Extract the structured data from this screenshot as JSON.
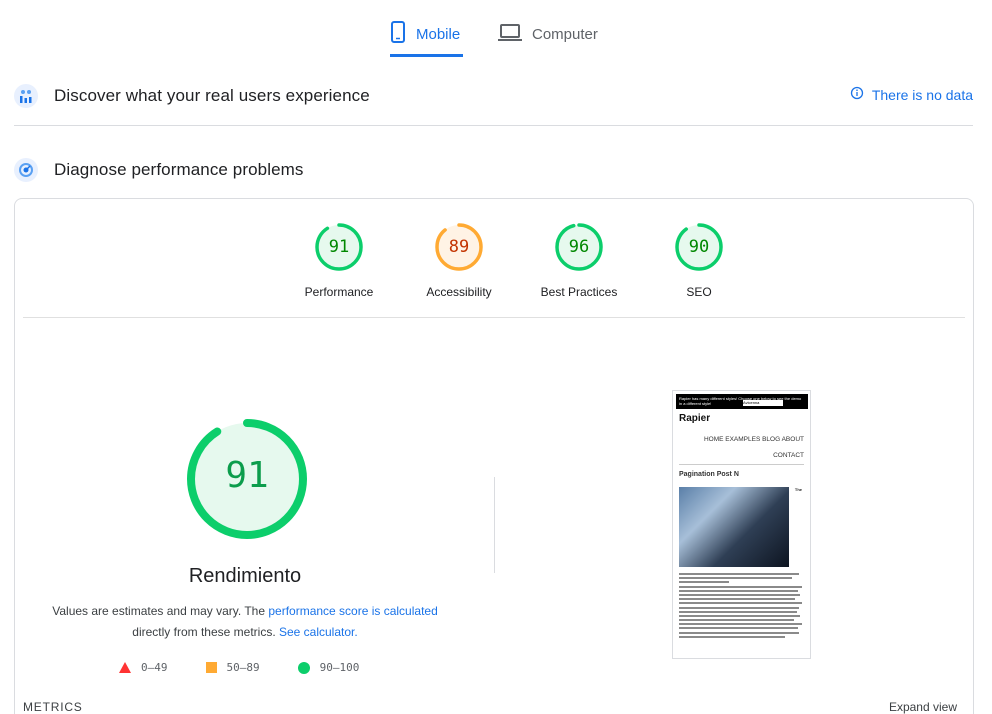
{
  "tabs": {
    "mobile_label": "Mobile",
    "computer_label": "Computer"
  },
  "field_section": {
    "title": "Discover what your real users experience",
    "no_data_label": "There is no data"
  },
  "lab_section": {
    "title": "Diagnose performance problems"
  },
  "gauges": [
    {
      "score": "91",
      "label": "Performance",
      "status": "pass"
    },
    {
      "score": "89",
      "label": "Accessibility",
      "status": "average"
    },
    {
      "score": "96",
      "label": "Best Practices",
      "status": "pass"
    },
    {
      "score": "90",
      "label": "SEO",
      "status": "pass"
    }
  ],
  "main_score": {
    "score": "91",
    "score_fraction": 0.91,
    "title": "Rendimiento",
    "desc_prefix": "Values are estimates and may vary. The ",
    "desc_link": "performance score is calculated",
    "desc_middle": "directly from these metrics. ",
    "calculator_link": "See calculator."
  },
  "legend": {
    "fail": "0–49",
    "average": "50–89",
    "pass": "90–100"
  },
  "thumbnail": {
    "banner": "Rapier has many different styles! Choose one below to see the demo in a different style!",
    "select_value": "Avicenna",
    "brand": "Rapier",
    "nav_line1": "HOME  EXAMPLES  BLOG  ABOUT",
    "nav_line2": "CONTACT",
    "post_title": "Pagination Post N",
    "side_text": "The"
  },
  "metrics_label": "METRICS",
  "expand_label": "Expand view",
  "colors": {
    "accent": "#1a73e8",
    "pass": "#0cce6b",
    "pass_text": "#008800",
    "pass_bg": "#e6f9ee",
    "average": "#ffaa33",
    "average_text": "#c33300",
    "average_bg": "#fff3e5",
    "fail": "#ff3333"
  }
}
